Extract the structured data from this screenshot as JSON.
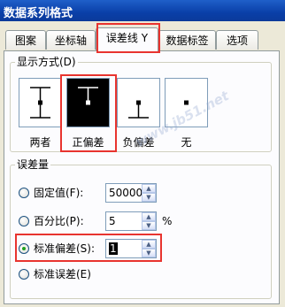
{
  "window": {
    "title": "数据系列格式"
  },
  "tabs": [
    {
      "label": "图案"
    },
    {
      "label": "坐标轴"
    },
    {
      "label": "误差线 Y",
      "active": true
    },
    {
      "label": "数据标签"
    },
    {
      "label": "选项"
    }
  ],
  "display": {
    "title": "显示方式(D)",
    "styles": [
      {
        "label": "两者",
        "icon": "error-bar-both-icon",
        "selected": false
      },
      {
        "label": "正偏差",
        "icon": "error-bar-plus-icon",
        "selected": true
      },
      {
        "label": "负偏差",
        "icon": "error-bar-minus-icon",
        "selected": false
      },
      {
        "label": "无",
        "icon": "error-bar-none-icon",
        "selected": false
      }
    ]
  },
  "amount": {
    "title": "误差量",
    "options": [
      {
        "label": "固定值(F):",
        "value": "50000",
        "checked": false
      },
      {
        "label": "百分比(P):",
        "value": "5",
        "unit": "%",
        "checked": false
      },
      {
        "label": "标准偏差(S):",
        "value": "1",
        "checked": true
      },
      {
        "label": "标准误差(E)",
        "checked": false
      }
    ]
  },
  "watermark": "www.jb51.net",
  "colors": {
    "highlight_box": "#e8342f",
    "title_bar": "#0a3fa8"
  }
}
